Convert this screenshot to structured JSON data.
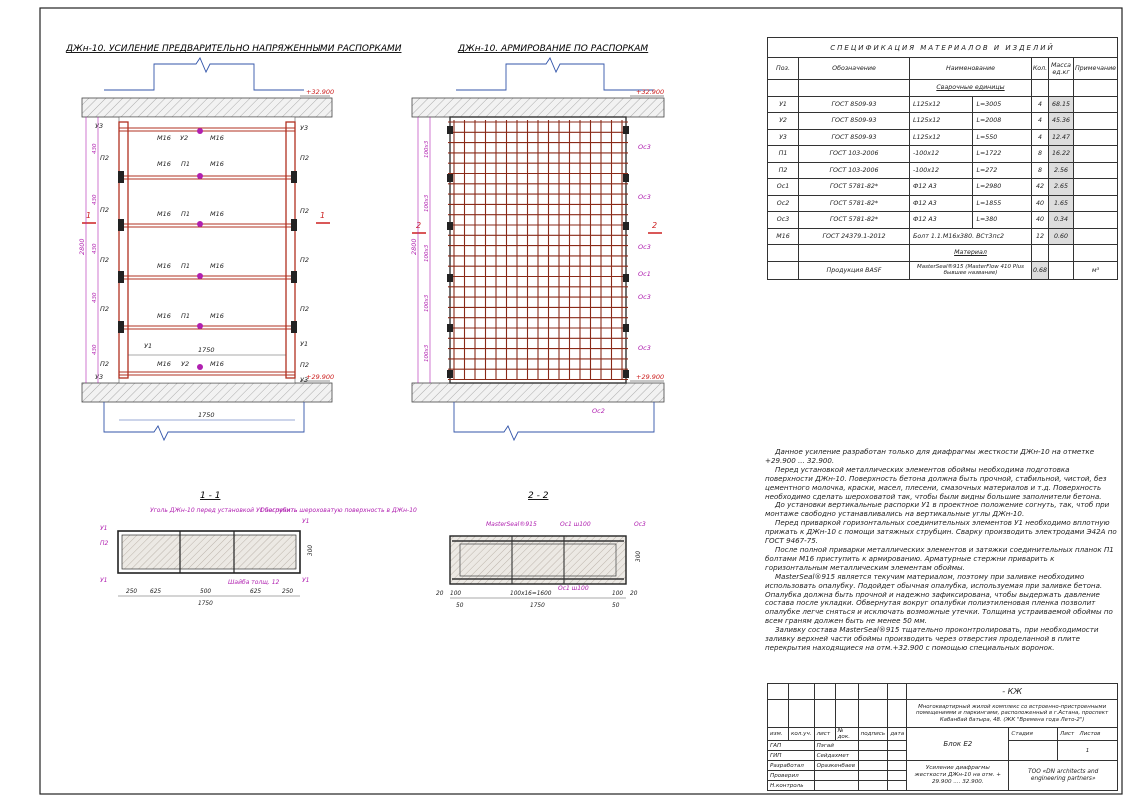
{
  "titles": {
    "elevation_left": "ДЖн-10. УСИЛЕНИЕ ПРЕДВАРИТЕЛЬНО НАПРЯЖЕННЫМИ РАСПОРКАМИ",
    "elevation_right": "ДЖн-10. АРМИРОВАНИЕ ПО РАСПОРКАМ",
    "section_1": "1 - 1",
    "section_2": "2 - 2"
  },
  "levels": {
    "top": "+32.900",
    "bottom": "+29.900"
  },
  "left_elevation": {
    "height_dim": "2800",
    "width_dim": "1750",
    "right_dims": [
      "1750"
    ],
    "left_dims": [
      "100",
      "430",
      "100",
      "430",
      "100",
      "430",
      "100",
      "430",
      "100",
      "430",
      "100"
    ],
    "labels": {
      "u3": "У3",
      "u2": "У2",
      "u1": "У1",
      "p1": "П1",
      "p2": "П2",
      "m16": "М16",
      "cut1": "1",
      "cut2": "2"
    }
  },
  "right_elevation": {
    "height_dim": "2800",
    "left_dims": [
      "150",
      "100x3",
      "230",
      "100x3",
      "230",
      "100x3",
      "230",
      "100x3",
      "230",
      "100x3",
      "150"
    ],
    "labels": {
      "oc1": "Ос1",
      "oc2": "Ос2",
      "oc3": "Ос3",
      "cut2": "2"
    }
  },
  "section_1": {
    "notes": [
      "Уголь ДЖн-10 перед установкой У1 загрубить",
      "Обеспечить шероховатую поверхность в ДЖн-10",
      "Шайба толщ. 12"
    ],
    "dims": [
      "250",
      "625",
      "500",
      "625",
      "250",
      "1750"
    ],
    "side_dims": [
      "12",
      "300",
      "12"
    ],
    "labels": {
      "u1": "У1",
      "p2": "П2"
    }
  },
  "section_2": {
    "notes": [
      "MasterSeal®915",
      "Ос1 ш100",
      "Ос3",
      "Ос1 ш100"
    ],
    "dims": [
      "20",
      "100",
      "100x16=1600",
      "100",
      "20",
      "50",
      "1750",
      "50"
    ],
    "side_dims": [
      "50",
      "60",
      "300",
      "60",
      "50"
    ],
    "labels": {
      "oc1": "Ос1"
    }
  },
  "spec": {
    "title": "СПЕЦИФИКАЦИЯ   МАТЕРИАЛОВ   И   ИЗДЕЛИЙ",
    "headers": {
      "pos": "Поз.",
      "designation": "Обозначение",
      "name": "Наименование",
      "qty": "Кол.",
      "mass": "Масса ед.кг",
      "note": "Примечание"
    },
    "section_welded": "Сварочные единицы",
    "rows": [
      {
        "pos": "У1",
        "doc": "ГОСТ 8509-93",
        "name": "L125х12",
        "len": "L=3005",
        "qty": "4",
        "mass": "68.15"
      },
      {
        "pos": "У2",
        "doc": "ГОСТ 8509-93",
        "name": "L125х12",
        "len": "L=2008",
        "qty": "4",
        "mass": "45.36"
      },
      {
        "pos": "У3",
        "doc": "ГОСТ 8509-93",
        "name": "L125х12",
        "len": "L=550",
        "qty": "4",
        "mass": "12.47"
      },
      {
        "pos": "П1",
        "doc": "ГОСТ 103-2006",
        "name": "-100х12",
        "len": "L=1722",
        "qty": "8",
        "mass": "16.22"
      },
      {
        "pos": "П2",
        "doc": "ГОСТ 103-2006",
        "name": "-100х12",
        "len": "L=272",
        "qty": "8",
        "mass": "2.56"
      },
      {
        "pos": "Ос1",
        "doc": "ГОСТ 5781-82*",
        "name": "Ф12 А3",
        "len": "L=2980",
        "qty": "42",
        "mass": "2.65"
      },
      {
        "pos": "Ос2",
        "doc": "ГОСТ 5781-82*",
        "name": "Ф12 А3",
        "len": "L=1855",
        "qty": "40",
        "mass": "1.65"
      },
      {
        "pos": "Ос3",
        "doc": "ГОСТ 5781-82*",
        "name": "Ф12 А3",
        "len": "L=380",
        "qty": "40",
        "mass": "0.34"
      },
      {
        "pos": "М16",
        "doc": "ГОСТ 24379.1-2012",
        "name": "Болт 1.1.М16х380. ВСт3пс2",
        "len": "",
        "qty": "12",
        "mass": "0.60"
      }
    ],
    "section_material": "Материал",
    "material": {
      "doc": "Продукция BASF",
      "name": "MasterSeal®915 (MasterFlow 410 Plus бывшее название)",
      "qty": "0.68",
      "note": "м³"
    }
  },
  "notes": [
    "Данное усиление разработан только для диафрагмы жесткости ДЖн-10 на отметке +29.900 ... 32.900.",
    "Перед установкой металлических элементов обоймы необходима подготовка поверхности ДЖн-10. Поверхность бетона должна быть прочной, стабильной, чистой, без цементного молочка, краски, масел, плесени, смазочных материалов и т.д. Поверхность необходимо сделать шероховатой так, чтобы были видны большие заполнители бетона.",
    "До установки вертикальные распорки У1 в проектное положение согнуть, так, чтоб при монтаже свободно устанавливались на вертикальные углы ДЖн-10.",
    "Перед приваркой горизонтальных соединительных элементов У1 необходимо вплотную прижать к ДЖн-10 с помощи затяжных струбцин. Сварку производить электродами Э42А по ГОСТ 9467-75.",
    "После полной приварки металлических элементов и затяжки соединительных планок П1 болтами М16 приступить к армированию. Арматурные стержни приварить к горизонтальным металлическим элементам обоймы.",
    "MasterSeal®915 является текучим материалом, поэтому при заливке необходимо использовать опалубку. Подойдет обычная опалубка, используемая при заливке бетона. Опалубка должна быть прочной и надежно зафиксирована, чтобы выдержать давление состава после укладки. Обвернутая вокруг опалубки полиэтиленовая пленка позволит опалубке легче сняться и исключать возможные утечки. Толщина устраиваемой обоймы по всем граням должен быть не менее 50 мм.",
    "Заливку состава MasterSeal®915 тщательно проконтролировать, при необходимости заливку верхней части обоймы производить через отверстия проделанной в плите перекрытия находящиеся на отм.+32.900 с помощью специальных воронок."
  ],
  "title_block": {
    "code": "- КЖ",
    "project": "Многоквартирный жилой комплекс со встроенно-пристроенными помещениями и паркингами, расположенный в г.Астана, проспект Кабанбай батыра, 48. (ЖК \"Времена года Лето-2\")",
    "block": "Блок Е2",
    "sheet_title": "Усиление диафрагмы жесткости ДЖн-10 на отм. + 29.900 .... 32.900.",
    "company": "ТОО «DN architects and engineering partners»",
    "stage_h": "Стадия",
    "sheet_h": "Лист",
    "sheets_h": "Листов",
    "sheet_no": "1",
    "col_heads": [
      "изм.",
      "кол.уч.",
      "лист",
      "№ док.",
      "подпись",
      "дата"
    ],
    "people": [
      {
        "role": "ГАП",
        "name": "Пэгай"
      },
      {
        "role": "ГИП",
        "name": "Сейдахмет"
      },
      {
        "role": "Разработал",
        "name": "Оразкенбаев"
      },
      {
        "role": "Проверил",
        "name": ""
      },
      {
        "role": "Н.контроль",
        "name": ""
      }
    ]
  }
}
